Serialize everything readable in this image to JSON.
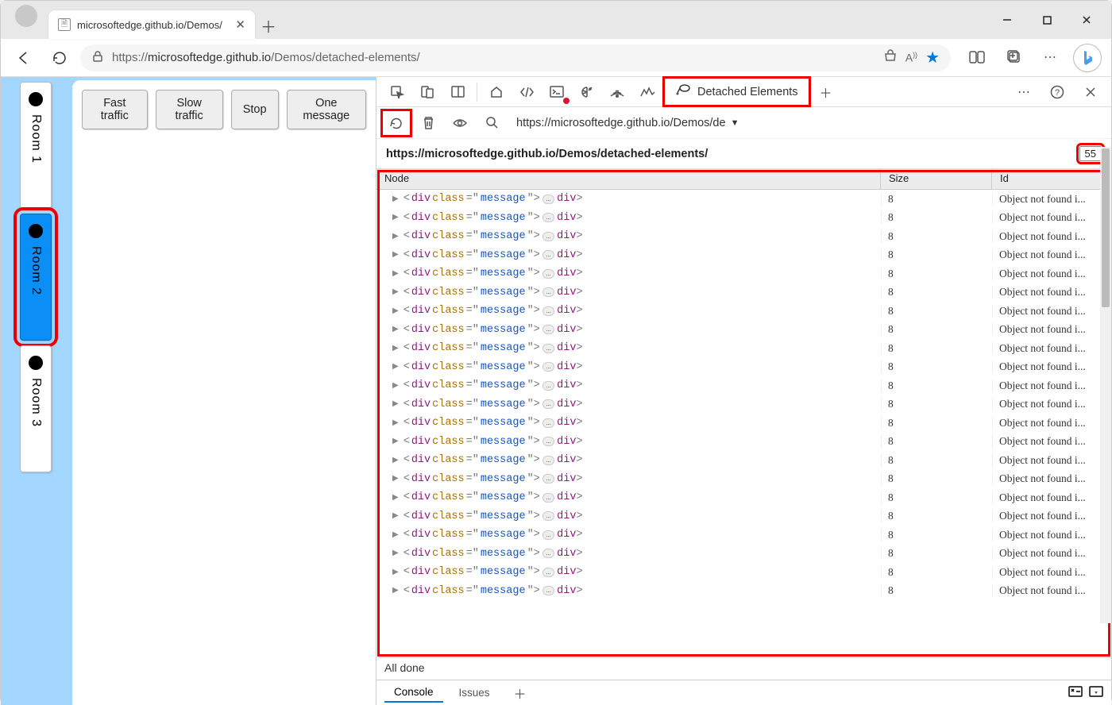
{
  "browser": {
    "tab_title": "microsoftedge.github.io/Demos/",
    "url_prefix": "https://",
    "url_host": "microsoftedge.github.io",
    "url_path": "/Demos/detached-elements/"
  },
  "page": {
    "rooms": [
      {
        "label": "Room 1",
        "active": false
      },
      {
        "label": "Room 2",
        "active": true
      },
      {
        "label": "Room 3",
        "active": false
      }
    ],
    "buttons": {
      "fast": "Fast traffic",
      "slow": "Slow traffic",
      "stop": "Stop",
      "one": "One message"
    }
  },
  "devtools": {
    "tab_label": "Detached Elements",
    "toolbar_url": "https://microsoftedge.github.io/Demos/de",
    "section_url": "https://microsoftedge.github.io/Demos/detached-elements/",
    "count": "55",
    "columns": {
      "node": "Node",
      "size": "Size",
      "id": "Id"
    },
    "rows": [
      {
        "size": "8",
        "id": "Object not found i..."
      },
      {
        "size": "8",
        "id": "Object not found i..."
      },
      {
        "size": "8",
        "id": "Object not found i..."
      },
      {
        "size": "8",
        "id": "Object not found i..."
      },
      {
        "size": "8",
        "id": "Object not found i..."
      },
      {
        "size": "8",
        "id": "Object not found i..."
      },
      {
        "size": "8",
        "id": "Object not found i..."
      },
      {
        "size": "8",
        "id": "Object not found i..."
      },
      {
        "size": "8",
        "id": "Object not found i..."
      },
      {
        "size": "8",
        "id": "Object not found i..."
      },
      {
        "size": "8",
        "id": "Object not found i..."
      },
      {
        "size": "8",
        "id": "Object not found i..."
      },
      {
        "size": "8",
        "id": "Object not found i..."
      },
      {
        "size": "8",
        "id": "Object not found i..."
      },
      {
        "size": "8",
        "id": "Object not found i..."
      },
      {
        "size": "8",
        "id": "Object not found i..."
      },
      {
        "size": "8",
        "id": "Object not found i..."
      },
      {
        "size": "8",
        "id": "Object not found i..."
      },
      {
        "size": "8",
        "id": "Object not found i..."
      },
      {
        "size": "8",
        "id": "Object not found i..."
      },
      {
        "size": "8",
        "id": "Object not found i..."
      },
      {
        "size": "8",
        "id": "Object not found i..."
      }
    ],
    "node_template": {
      "open_bracket": "<",
      "tag": "div",
      "attr_name": "class",
      "attr_eq": "=",
      "quote": "\"",
      "attr_val": "message",
      "close_bracket": ">",
      "ellipsis": "…",
      "open_end": "</",
      "end_bracket": ">"
    },
    "status": "All done",
    "drawer": {
      "console": "Console",
      "issues": "Issues"
    }
  }
}
